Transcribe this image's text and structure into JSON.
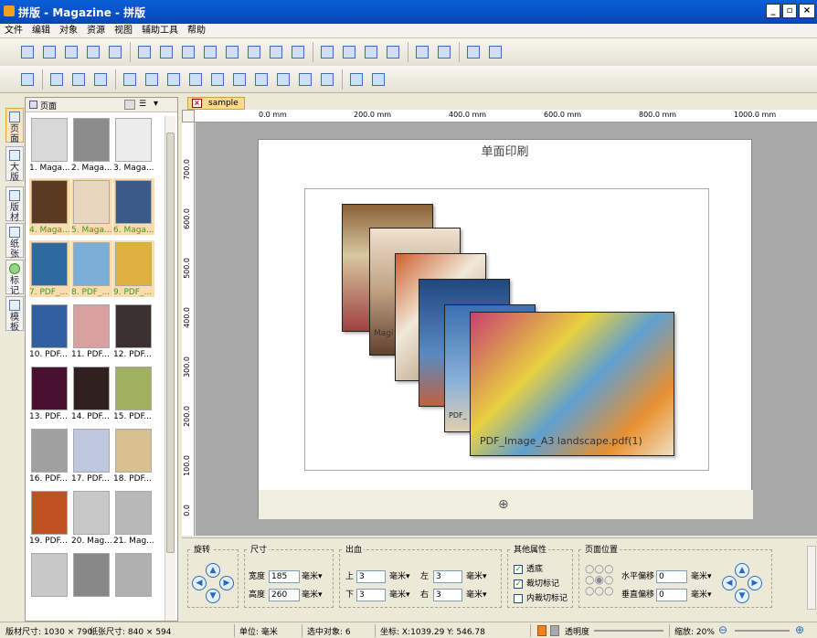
{
  "window": {
    "title": "拼版 - Magazine - 拼版",
    "min": "_",
    "max": "▫",
    "close": "×"
  },
  "menu": [
    "文件",
    "编辑",
    "对象",
    "资源",
    "视图",
    "辅助工具",
    "帮助"
  ],
  "toolbar1": [
    "new-doc",
    "save",
    "save-template",
    "open-template",
    "page-setup",
    "undo",
    "redo",
    "crop-marks",
    "delete",
    "cut",
    "link",
    "single-page",
    "multi-page",
    "page",
    "select",
    "zoom",
    "refresh",
    "preview",
    "print-preview",
    "layout-a",
    "layout-b"
  ],
  "toolbar2": [
    "align-grid",
    "frame",
    "lock",
    "unlock",
    "align-left",
    "align-center",
    "align-right",
    "distribute-h",
    "align-top",
    "align-middle",
    "align-bottom",
    "grid-view",
    "h-split",
    "v-split",
    "export",
    "import"
  ],
  "lefttabs": [
    "页面",
    "大版",
    "版材",
    "纸张",
    "标记",
    "模板"
  ],
  "leftpanel": {
    "title": "页面",
    "thumbs": [
      {
        "label": "1. Maga...",
        "color": "#d8d8d8"
      },
      {
        "label": "2. Maga...",
        "color": "#8c8c8c"
      },
      {
        "label": "3. Maga...",
        "color": "#ececec"
      },
      {
        "label": "4. Maga...",
        "color": "#5a3a20"
      },
      {
        "label": "5. Maga...",
        "color": "#e8d6c0"
      },
      {
        "label": "6. Maga...",
        "color": "#3a5a8a"
      },
      {
        "label": "7. PDF_...",
        "color": "#2e6aa0"
      },
      {
        "label": "8. PDF_...",
        "color": "#7ab0d8"
      },
      {
        "label": "9. PDF_...",
        "color": "#e0b040"
      },
      {
        "label": "10. PDF...",
        "color": "#3060a0"
      },
      {
        "label": "11. PDF...",
        "color": "#d8a0a0"
      },
      {
        "label": "12. PDF...",
        "color": "#3a3030"
      },
      {
        "label": "13. PDF...",
        "color": "#4a1030"
      },
      {
        "label": "14. PDF...",
        "color": "#302020"
      },
      {
        "label": "15. PDF...",
        "color": "#a0b060"
      },
      {
        "label": "16. PDF...",
        "color": "#a0a0a0"
      },
      {
        "label": "17. PDF...",
        "color": "#c0c8e0"
      },
      {
        "label": "18. PDF...",
        "color": "#d8c090"
      },
      {
        "label": "19. PDF...",
        "color": "#c05020"
      },
      {
        "label": "20. Mag...",
        "color": "#c8c8c8"
      },
      {
        "label": "21. Mag...",
        "color": "#b8b8b8"
      },
      {
        "label": "",
        "color": "#c8c8c8"
      },
      {
        "label": "",
        "color": "#888"
      },
      {
        "label": "",
        "color": "#b0b0b0"
      }
    ]
  },
  "doctab": {
    "label": "sample"
  },
  "ruler_h": [
    "0.0 mm",
    "200.0 mm",
    "400.0 mm",
    "600.0 mm",
    "800.0 mm",
    "1000.0 mm"
  ],
  "ruler_v": [
    "700.0",
    "600.0",
    "500.0",
    "400.0",
    "300.0",
    "200.0",
    "100.0",
    "0.0"
  ],
  "sheet": {
    "title": "单面印刷",
    "filename": "PDF_Image_A3 landscape.pdf(1)",
    "tag": "Magi",
    "tag2": "PDF_"
  },
  "bottom": {
    "rotate": {
      "title": "旋转"
    },
    "size": {
      "title": "尺寸",
      "width_label": "宽度",
      "width": "185",
      "height_label": "高度",
      "height": "260",
      "unit": "毫米▾"
    },
    "bleed": {
      "title": "出血",
      "top_label": "上",
      "top": "3",
      "bottom_label": "下",
      "bottom": "3",
      "left_label": "左",
      "left": "3",
      "right_label": "右",
      "right": "3",
      "unit": "毫米▾"
    },
    "other": {
      "title": "其他属性",
      "transparent": "透底",
      "crop": "裁切标记",
      "inner_crop": "内裁切标记"
    },
    "pos": {
      "title": "页面位置",
      "h_label": "水平偏移",
      "h": "0",
      "v_label": "垂直偏移",
      "v": "0",
      "unit": "毫米▾"
    }
  },
  "status": {
    "plate": "版材尺寸: 1030 × 790",
    "paper": "纸张尺寸: 840 × 594",
    "unit": "单位: 毫米",
    "selected": "选中对象: 6",
    "coord": "坐标: X:1039.29  Y: 546.78",
    "opacity": "透明度",
    "zoom": "缩放: 20%"
  }
}
